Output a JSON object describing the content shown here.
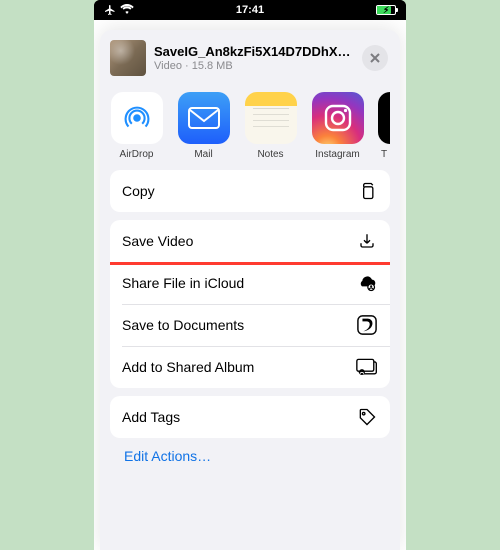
{
  "status": {
    "time": "17:41"
  },
  "file": {
    "name": "SaveIG_An8kzFi5X14D7DDhXM…",
    "kind": "Video",
    "size": "15.8 MB"
  },
  "apps": [
    {
      "id": "airdrop",
      "label": "AirDrop"
    },
    {
      "id": "mail",
      "label": "Mail"
    },
    {
      "id": "notes",
      "label": "Notes"
    },
    {
      "id": "instagram",
      "label": "Instagram"
    },
    {
      "id": "partial",
      "label": "T"
    }
  ],
  "actions": {
    "copy": "Copy",
    "saveVideo": "Save Video",
    "shareCloud": "Share File in iCloud",
    "saveDocs": "Save to Documents",
    "addShared": "Add to Shared Album",
    "addTags": "Add Tags"
  },
  "editActions": "Edit Actions…",
  "colors": {
    "highlight": "#ff3b30",
    "link": "#1173e6",
    "sheetBg": "#f2f2f6"
  }
}
